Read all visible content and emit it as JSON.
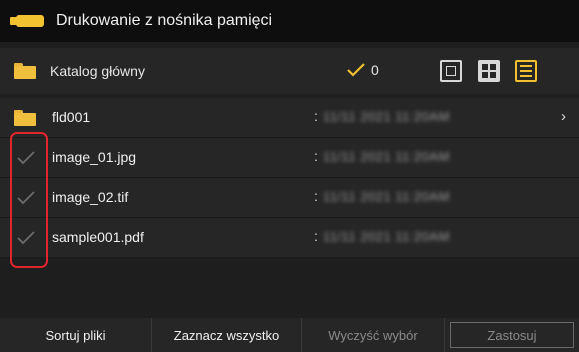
{
  "title": "Drukowanie z nośnika pamięci",
  "header": {
    "folder_label": "Katalog główny",
    "selected_count": "0"
  },
  "rows": [
    {
      "type": "folder",
      "name": "fld001",
      "date": "11/11 2021 11:20AM"
    },
    {
      "type": "file",
      "name": "image_01.jpg",
      "date": "11/11 2021 11:20AM"
    },
    {
      "type": "file",
      "name": "image_02.tif",
      "date": "11/11 2021 11:20AM"
    },
    {
      "type": "file",
      "name": "sample001.pdf",
      "date": "11/11 2021 11:20AM"
    }
  ],
  "colon": ":",
  "footer": {
    "sort": "Sortuj pliki",
    "select_all": "Zaznacz wszystko",
    "clear": "Wyczyść wybór",
    "apply": "Zastosuj"
  },
  "colors": {
    "accent": "#f0c030",
    "highlight_box": "#e0262b"
  }
}
